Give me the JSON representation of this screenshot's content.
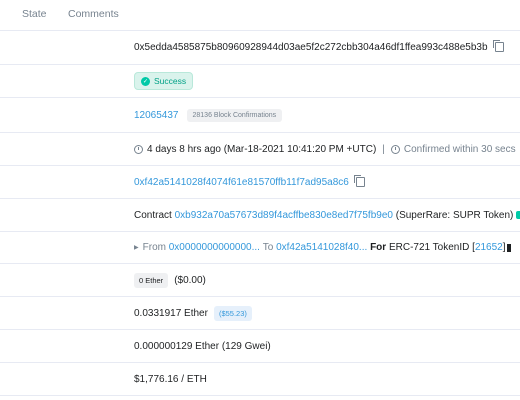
{
  "tabs": {
    "state": "State",
    "comments": "Comments"
  },
  "tx_hash": "0x5edda4585875b80960928944d03ae5f2c272cbb304a46df1ffea993c488e5b3b",
  "status": "Success",
  "block": {
    "number": "12065437",
    "confirmations": "28136 Block Confirmations"
  },
  "timestamp": {
    "age": "4 days 8 hrs ago (Mar-18-2021 10:41:20 PM +UTC)",
    "separator": "|",
    "confirmed": "Confirmed within 30 secs"
  },
  "from_address": "0xf42a5141028f4074f61e81570ffb11f7ad95a8c6",
  "interacted": {
    "prefix": "Contract",
    "address": "0xb932a70a57673d89f4acffbe830e8ed7f75fb9e0",
    "name": "(SuperRare: SUPR Token)"
  },
  "transfer": {
    "from_label": "From",
    "from_addr": "0x0000000000000...",
    "to_label": "To",
    "to_addr": "0xf42a5141028f40...",
    "for_label": "For",
    "token_label": "ERC-721 TokenID",
    "token_id_open": "[",
    "token_id": "21652",
    "token_id_close": "]"
  },
  "value": {
    "ether": "0 Ether",
    "usd": "($0.00)"
  },
  "fee": {
    "ether": "0.0331917 Ether",
    "usd": "($55.23)"
  },
  "gas_price": "0.000000129 Ether (129 Gwei)",
  "ether_price": "$1,776.16 / ETH",
  "colors": {
    "link": "#3498db",
    "success": "#00c9a7",
    "border": "#e7eaf3",
    "muted": "#77838f"
  },
  "icons": {
    "copy": "copy-icon",
    "check": "check-circle-icon",
    "clock": "clock-icon",
    "triangle": "caret-right-icon"
  }
}
